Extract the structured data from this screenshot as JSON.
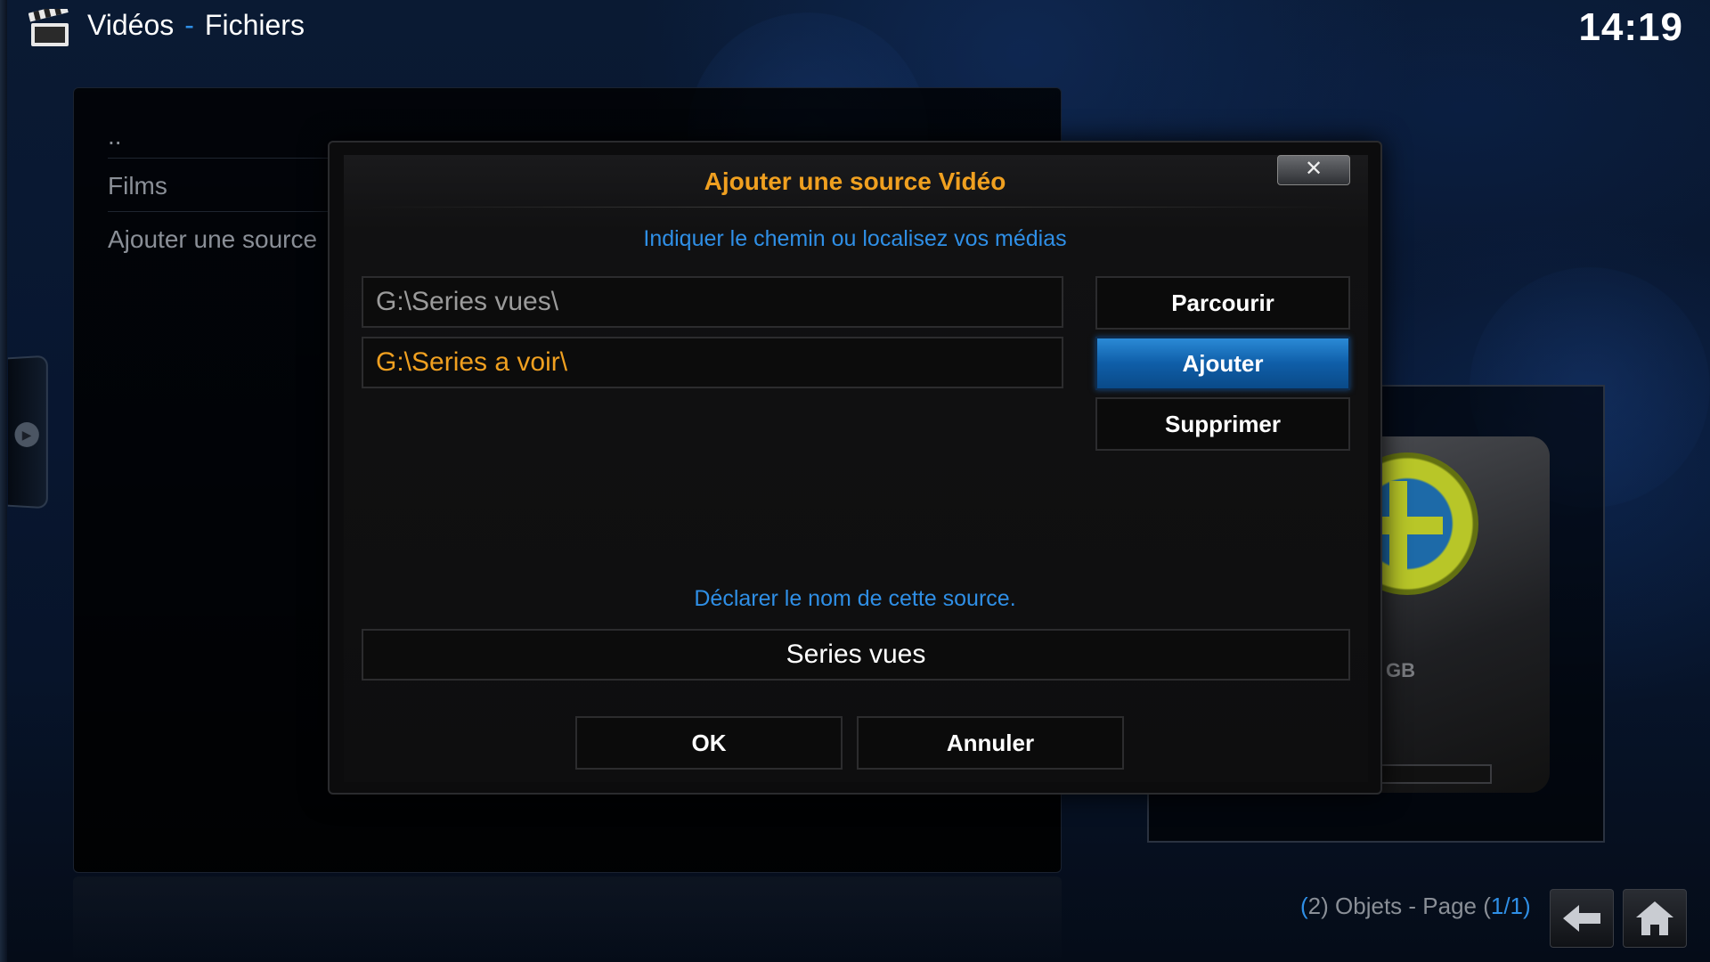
{
  "header": {
    "section": "Vidéos",
    "separator": "-",
    "subsection": "Fichiers",
    "clock": "14:19",
    "icon": "film-clapper-icon"
  },
  "file_list": {
    "items": [
      {
        "label": ".."
      },
      {
        "label": "Films"
      },
      {
        "label": "Ajouter une source"
      }
    ]
  },
  "dialog": {
    "title": "Ajouter une source Vidéo",
    "close_icon": "close-x-icon",
    "path_hint": "Indiquer le chemin ou localisez vos médias",
    "paths": [
      {
        "value": "G:\\Series vues\\",
        "selected": false
      },
      {
        "value": "G:\\Series a voir\\",
        "selected": true
      }
    ],
    "browse_label": "Parcourir",
    "add_label": "Ajouter",
    "remove_label": "Supprimer",
    "name_hint": "Déclarer le nom de cette source.",
    "source_name": "Series vues",
    "ok_label": "OK",
    "cancel_label": "Annuler"
  },
  "thumbnail": {
    "capacity_text": "GB",
    "icon": "hard-drive-add-icon"
  },
  "footer": {
    "open_paren": "(",
    "count": "2",
    "objects_text": ") Objets - Page (",
    "page": "1/1",
    "close_paren": ")",
    "back_icon": "back-arrow-icon",
    "home_icon": "home-icon"
  },
  "colors": {
    "accent_blue": "#2f8fe6",
    "accent_orange": "#f0a020",
    "focus_button": "#0f5ea8"
  }
}
